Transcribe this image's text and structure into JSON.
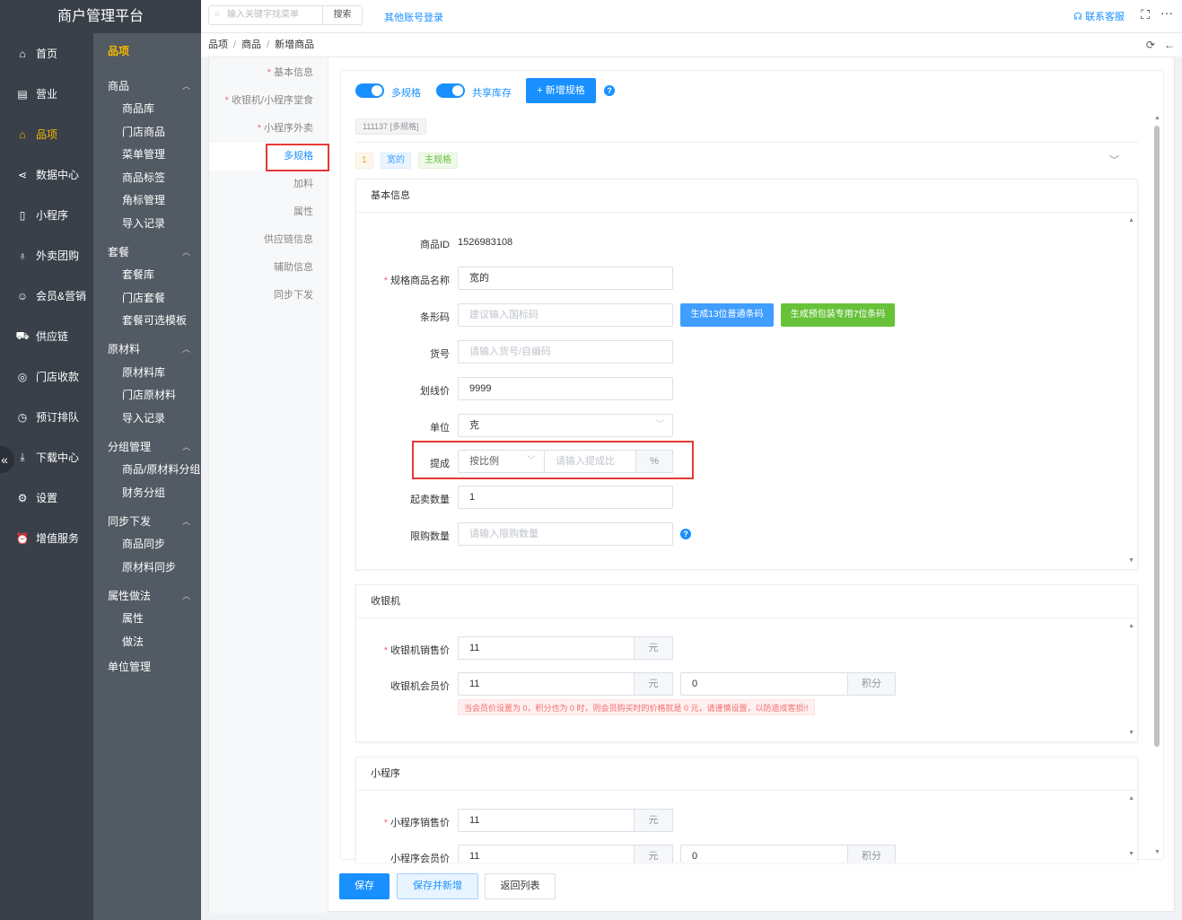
{
  "app": {
    "title": "商户管理平台"
  },
  "topbar": {
    "search_placeholder": "输入关键字找菜单",
    "search_button": "搜索",
    "other_login": "其他账号登录",
    "contact": "联系客服"
  },
  "nav": [
    {
      "label": "首页",
      "icon": "home-icon"
    },
    {
      "label": "营业",
      "icon": "calendar-icon"
    },
    {
      "label": "品项",
      "icon": "bag-icon"
    },
    {
      "label": "数据中心",
      "icon": "share-icon"
    },
    {
      "label": "小程序",
      "icon": "phone-icon"
    },
    {
      "label": "外卖团购",
      "icon": "bike-icon"
    },
    {
      "label": "会员&营销",
      "icon": "user-icon"
    },
    {
      "label": "供应链",
      "icon": "truck-icon"
    },
    {
      "label": "门店收款",
      "icon": "coins-icon"
    },
    {
      "label": "预订排队",
      "icon": "clock-icon"
    },
    {
      "label": "下载中心",
      "icon": "download-icon"
    },
    {
      "label": "设置",
      "icon": "gear-icon"
    },
    {
      "label": "增值服务",
      "icon": "alarm-icon"
    }
  ],
  "subnav": {
    "title": "品项",
    "groups": [
      {
        "label": "商品",
        "items": [
          "商品库",
          "门店商品",
          "菜单管理",
          "商品标签",
          "角标管理",
          "导入记录"
        ]
      },
      {
        "label": "套餐",
        "items": [
          "套餐库",
          "门店套餐",
          "套餐可选模板"
        ]
      },
      {
        "label": "原材料",
        "items": [
          "原材料库",
          "门店原材料",
          "导入记录"
        ]
      },
      {
        "label": "分组管理",
        "items": [
          "商品/原材料分组",
          "财务分组"
        ]
      },
      {
        "label": "同步下发",
        "items": [
          "商品同步",
          "原材料同步"
        ]
      },
      {
        "label": "属性做法",
        "items": [
          "属性",
          "做法"
        ]
      }
    ],
    "plain": "单位管理"
  },
  "breadcrumb": [
    "品项",
    "商品",
    "新增商品"
  ],
  "side_tabs": [
    {
      "label": "基本信息",
      "required": true
    },
    {
      "label": "收银机/小程序堂食",
      "required": true
    },
    {
      "label": "小程序外卖",
      "required": true
    },
    {
      "label": "多规格",
      "required": false
    },
    {
      "label": "加料",
      "required": false
    },
    {
      "label": "属性",
      "required": false
    },
    {
      "label": "供应链信息",
      "required": false
    },
    {
      "label": "辅助信息",
      "required": false
    },
    {
      "label": "同步下发",
      "required": false
    }
  ],
  "spec": {
    "multi_spec_label": "多规格",
    "shared_stock_label": "共享库存",
    "add_spec_button": "+ 新增规格",
    "sku_tag": "111137 [多规格]",
    "row_tags": {
      "index": "1",
      "name": "宽的",
      "main": "主规格"
    }
  },
  "basic": {
    "title": "基本信息",
    "product_id_label": "商品ID",
    "product_id": "1526983108",
    "name_label": "规格商品名称",
    "name_value": "宽的",
    "barcode_label": "条形码",
    "barcode_placeholder": "建议输入国标码",
    "gen13_button": "生成13位普通条码",
    "gen7_button": "生成预包装专用7位条码",
    "sku_label": "货号",
    "sku_placeholder": "请输入货号/自编码",
    "strike_label": "划线价",
    "strike_value": "9999",
    "unit_label": "单位",
    "unit_value": "克",
    "commission_label": "提成",
    "commission_mode": "按比例",
    "commission_placeholder": "请输入提成比",
    "commission_unit": "%",
    "min_qty_label": "起卖数量",
    "min_qty_value": "1",
    "limit_label": "限购数量",
    "limit_placeholder": "请输入限购数量"
  },
  "pos": {
    "title": "收银机",
    "sale_label": "收银机销售价",
    "sale_value": "11",
    "yuan": "元",
    "member_label": "收银机会员价",
    "member_value": "11",
    "points_value": "0",
    "points_unit": "积分",
    "warning": "当会员价设置为 0，积分也为 0 时，则会员购买时的价格就是 0 元，请谨慎设置，以防造成客损!!"
  },
  "mini": {
    "title": "小程序",
    "sale_label": "小程序销售价",
    "sale_value": "11",
    "yuan": "元",
    "member_label": "小程序会员价",
    "member_value": "11",
    "points_value": "0",
    "points_unit": "积分"
  },
  "footer": {
    "save": "保存",
    "save_new": "保存并新增",
    "back": "返回列表"
  },
  "colors": {
    "primary": "#1890ff",
    "sidebar": "#394049",
    "submenu": "#525a63",
    "active": "#f5b800",
    "green": "#67c23a",
    "highlight": "#e53935"
  }
}
